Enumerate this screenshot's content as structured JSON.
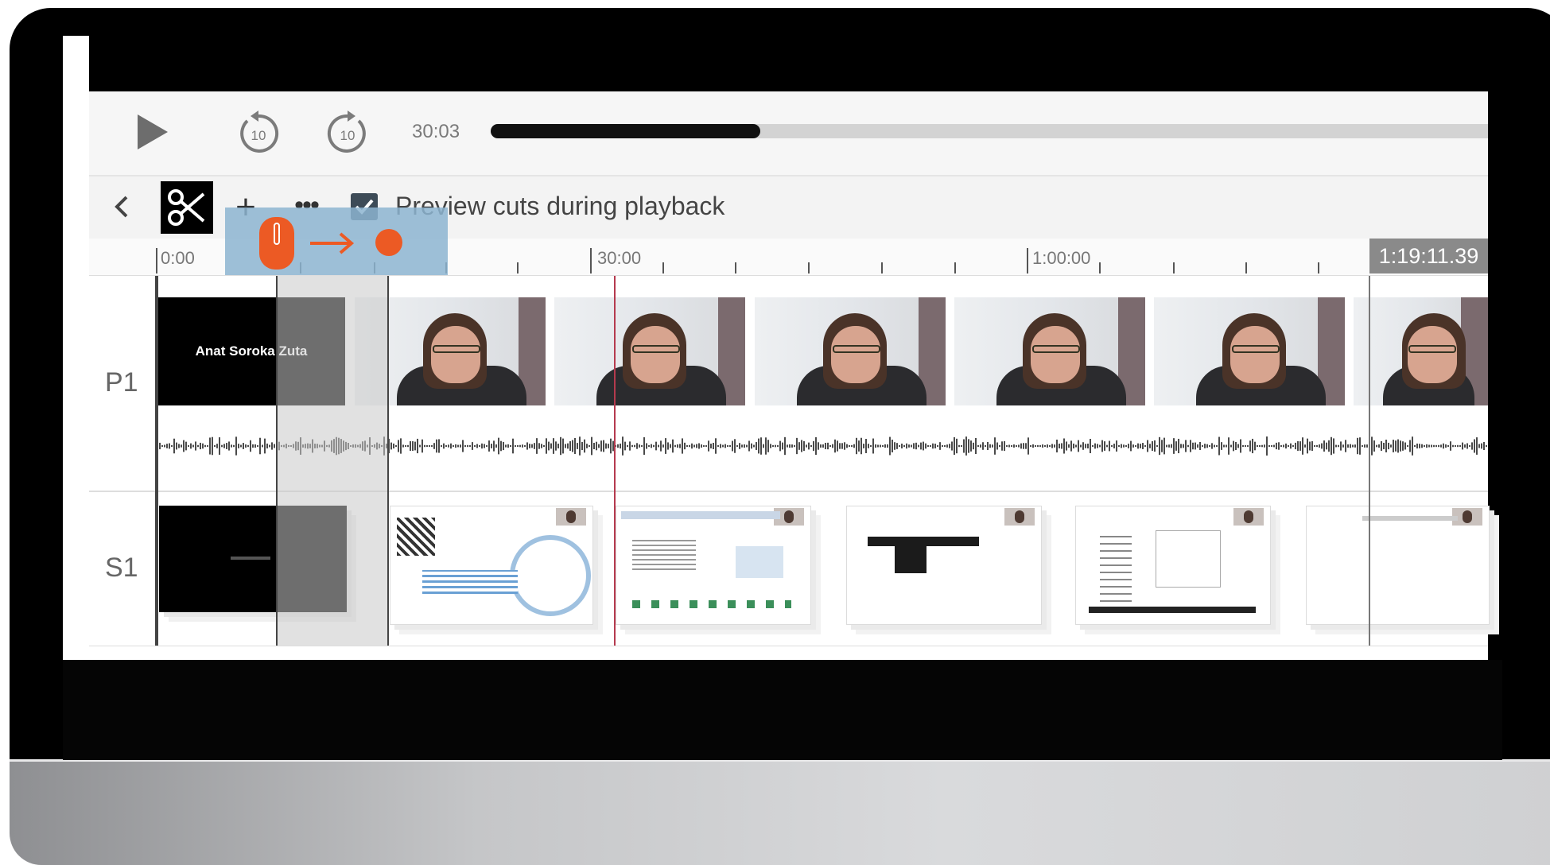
{
  "player": {
    "time_label": "30:03",
    "progress_fraction": 0.27,
    "icons": {
      "play": "play-icon",
      "back": "rewind-10-icon",
      "forward": "forward-10-icon"
    },
    "skip_back_label": "10",
    "skip_forward_label": "10"
  },
  "toolbar": {
    "preview_checkbox_checked": true,
    "preview_label": "Preview cuts during playback",
    "add_label": "+",
    "more_label": "•••",
    "icons": {
      "back": "chevron-left-icon",
      "cut": "scissors-icon",
      "add": "plus-icon",
      "more": "ellipsis-icon"
    }
  },
  "ruler": {
    "labels": [
      "0:00",
      "30:00",
      "1:00:00"
    ],
    "end_time": "1:19:11.39"
  },
  "tracks": {
    "p1": {
      "label": "P1",
      "title_card_text": "Anat Soroka Zuta"
    },
    "s1": {
      "label": "S1"
    }
  },
  "hint": {
    "icons": [
      "mouse-icon",
      "arrow-right-icon",
      "dot-icon"
    ]
  },
  "colors": {
    "accent_orange": "#ec5a24",
    "hint_blue": "#8cb4d0",
    "playhead": "#b53a4e",
    "checkbox": "#3d4b57"
  }
}
